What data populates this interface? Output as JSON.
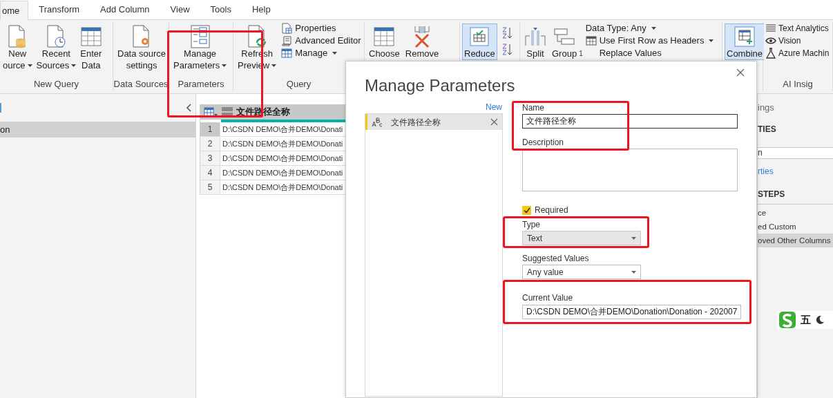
{
  "ribbon": {
    "tabs": [
      {
        "label": "ome",
        "selected": true
      },
      {
        "label": "Transform",
        "selected": false
      },
      {
        "label": "Add Column",
        "selected": false
      },
      {
        "label": "View",
        "selected": false
      },
      {
        "label": "Tools",
        "selected": false
      },
      {
        "label": "Help",
        "selected": false
      }
    ],
    "groups": [
      {
        "label": "New Query",
        "buttons": [
          {
            "kind": "large",
            "lines": [
              "New",
              "ource"
            ],
            "dropdown": true,
            "on": false
          },
          {
            "kind": "large",
            "lines": [
              "Recent",
              "Sources"
            ],
            "dropdown": true,
            "on": false
          },
          {
            "kind": "large",
            "lines": [
              "Enter",
              "Data"
            ],
            "dropdown": false,
            "on": false
          }
        ]
      },
      {
        "label": "Data Sources",
        "buttons": [
          {
            "kind": "large",
            "lines": [
              "Data source",
              "settings"
            ],
            "dropdown": false,
            "on": false
          }
        ]
      },
      {
        "label": "Parameters",
        "buttons": [
          {
            "kind": "large",
            "lines": [
              "Manage",
              "Parameters"
            ],
            "dropdown": true,
            "on": false
          }
        ]
      },
      {
        "label": "Query",
        "buttons": [
          {
            "kind": "large",
            "lines": [
              "Refresh",
              "Preview"
            ],
            "dropdown": true,
            "on": false
          },
          {
            "kind": "small",
            "lines": [
              "Properties"
            ],
            "dropdown": false,
            "on": false
          },
          {
            "kind": "small",
            "lines": [
              "Advanced Editor"
            ],
            "dropdown": false,
            "on": false
          },
          {
            "kind": "small",
            "lines": [
              "Manage"
            ],
            "dropdown": true,
            "on": false
          }
        ]
      },
      {
        "buttons": [
          {
            "kind": "large",
            "lines": [
              "Choose"
            ],
            "dropdown": false,
            "on": false
          },
          {
            "kind": "large",
            "lines": [
              "Remove"
            ],
            "dropdown": false,
            "on": false
          }
        ]
      },
      {
        "buttons": [
          {
            "kind": "large",
            "lines": [
              "Reduce"
            ],
            "dropdown": false,
            "on": true
          },
          {
            "kind": "icon"
          },
          {
            "kind": "icon"
          }
        ]
      },
      {
        "marker": "1",
        "buttons": [
          {
            "kind": "large",
            "lines": [
              "Split"
            ],
            "dropdown": false,
            "on": false
          },
          {
            "kind": "large",
            "lines": [
              "Group"
            ],
            "dropdown": false,
            "on": false
          },
          {
            "kind": "small",
            "lines": [
              "Data Type: Any"
            ],
            "dropdown": true,
            "on": false
          },
          {
            "kind": "small",
            "lines": [
              "Use First Row as Headers"
            ],
            "dropdown": true,
            "on": false
          },
          {
            "kind": "small",
            "lines": [
              "Replace Values"
            ],
            "dropdown": false,
            "on": false
          }
        ]
      },
      {
        "buttons": [
          {
            "kind": "large",
            "lines": [
              "Combine"
            ],
            "dropdown": false,
            "on": true
          }
        ]
      },
      {
        "label": "AI Insig",
        "buttons": [
          {
            "kind": "small",
            "lines": [
              "Text Analytics"
            ],
            "dropdown": false,
            "on": false
          },
          {
            "kind": "small",
            "lines": [
              "Vision"
            ],
            "dropdown": false,
            "on": false
          },
          {
            "kind": "small",
            "lines": [
              "Azure Machin"
            ],
            "dropdown": false,
            "on": false
          }
        ]
      }
    ]
  },
  "queries": {
    "items": [
      {
        "label": "on",
        "selected": true
      }
    ]
  },
  "grid": {
    "column": "文件路径全称",
    "rows": [
      {
        "number": "1",
        "value": "D:\\CSDN DEMO\\合并DEMO\\Donati",
        "selected": true
      },
      {
        "number": "2",
        "value": "D:\\CSDN DEMO\\合并DEMO\\Donati",
        "selected": false
      },
      {
        "number": "3",
        "value": "D:\\CSDN DEMO\\合并DEMO\\Donati",
        "selected": false
      },
      {
        "number": "4",
        "value": "D:\\CSDN DEMO\\合并DEMO\\Donati",
        "selected": false
      },
      {
        "number": "5",
        "value": "D:\\CSDN DEMO\\合并DEMO\\Donati",
        "selected": false
      }
    ]
  },
  "dialog": {
    "title": "Manage Parameters",
    "new_link": "New",
    "parameters": [
      {
        "name": "文件路径全称",
        "selected": true
      }
    ],
    "name": {
      "label": "Name",
      "value": "文件路径全称"
    },
    "description": {
      "label": "Description"
    },
    "required": {
      "label": "Required",
      "checked": true
    },
    "type": {
      "label": "Type",
      "value": "Text",
      "highlighted": true
    },
    "suggested_values": {
      "label": "Suggested Values",
      "value": "Any value",
      "highlighted": false
    },
    "current_value": {
      "label": "Current Value",
      "value": "D:\\CSDN DEMO\\合并DEMO\\Donation\\Donation - 202007"
    }
  },
  "query_settings": {
    "title": "ings",
    "properties_heading": "TIES",
    "name_value": "n",
    "properties_link": "rties",
    "steps_heading": "STEPS",
    "steps": [
      {
        "label": "ce",
        "selected": false
      },
      {
        "label": "ed Custom",
        "selected": false
      },
      {
        "label": "oved Other Columns",
        "selected": true
      }
    ]
  },
  "ime": {
    "mode": "五"
  }
}
